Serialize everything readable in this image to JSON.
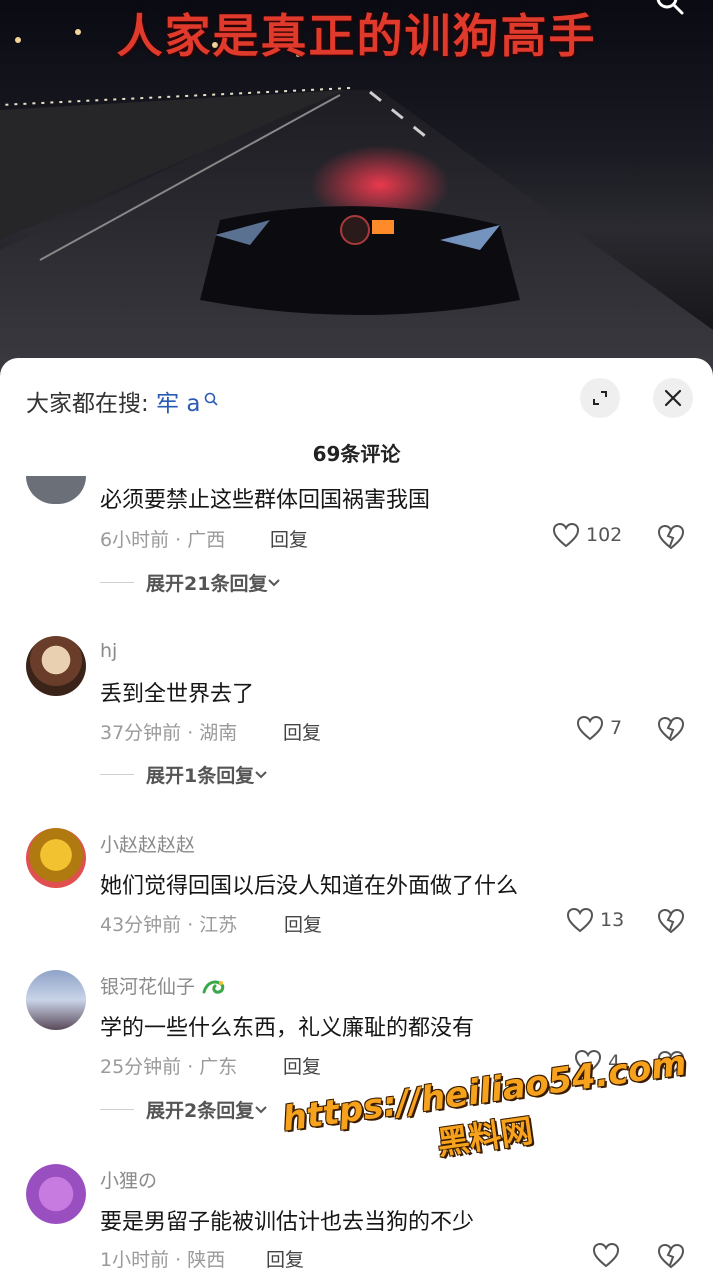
{
  "video": {
    "title": "人家是真正的训狗高手"
  },
  "sheet": {
    "search_label": "大家都在搜:",
    "search_keyword": "牢 a",
    "comment_count": "69条评论"
  },
  "comments": [
    {
      "username": "",
      "text": "必须要禁止这些群体回国祸害我国",
      "meta": "6小时前 · 广西",
      "reply": "回复",
      "likes": "102",
      "expand": "展开21条回复"
    },
    {
      "username": "hj",
      "text": "丢到全世界去了",
      "meta": "37分钟前 · 湖南",
      "reply": "回复",
      "likes": "7",
      "expand": "展开1条回复"
    },
    {
      "username": "小赵赵赵赵",
      "text": "她们觉得回国以后没人知道在外面做了什么",
      "meta": "43分钟前 · 江苏",
      "reply": "回复",
      "likes": "13",
      "expand": ""
    },
    {
      "username": "银河花仙子",
      "text": "学的一些什么东西，礼义廉耻的都没有",
      "meta": "25分钟前 · 广东",
      "reply": "回复",
      "likes": "4",
      "expand": "展开2条回复"
    },
    {
      "username": "小狸の",
      "text": "要是男留子能被训估计也去当狗的不少",
      "meta": "1小时前 · 陕西",
      "reply": "回复",
      "likes": "",
      "expand": ""
    }
  ],
  "watermark": {
    "url": "https://heiliao54.com",
    "name": "黑料网"
  },
  "icons": {
    "search": "search-icon",
    "expand": "fullscreen-icon",
    "close": "close-icon",
    "like": "heart-icon",
    "dislike": "broken-heart-icon",
    "chevron": "chevron-down-icon",
    "dragon": "dragon-emoji-icon"
  },
  "colors": {
    "title_red": "#e03a2c",
    "link_blue": "#2a5bb3",
    "watermark_orange": "#f6a21c"
  }
}
